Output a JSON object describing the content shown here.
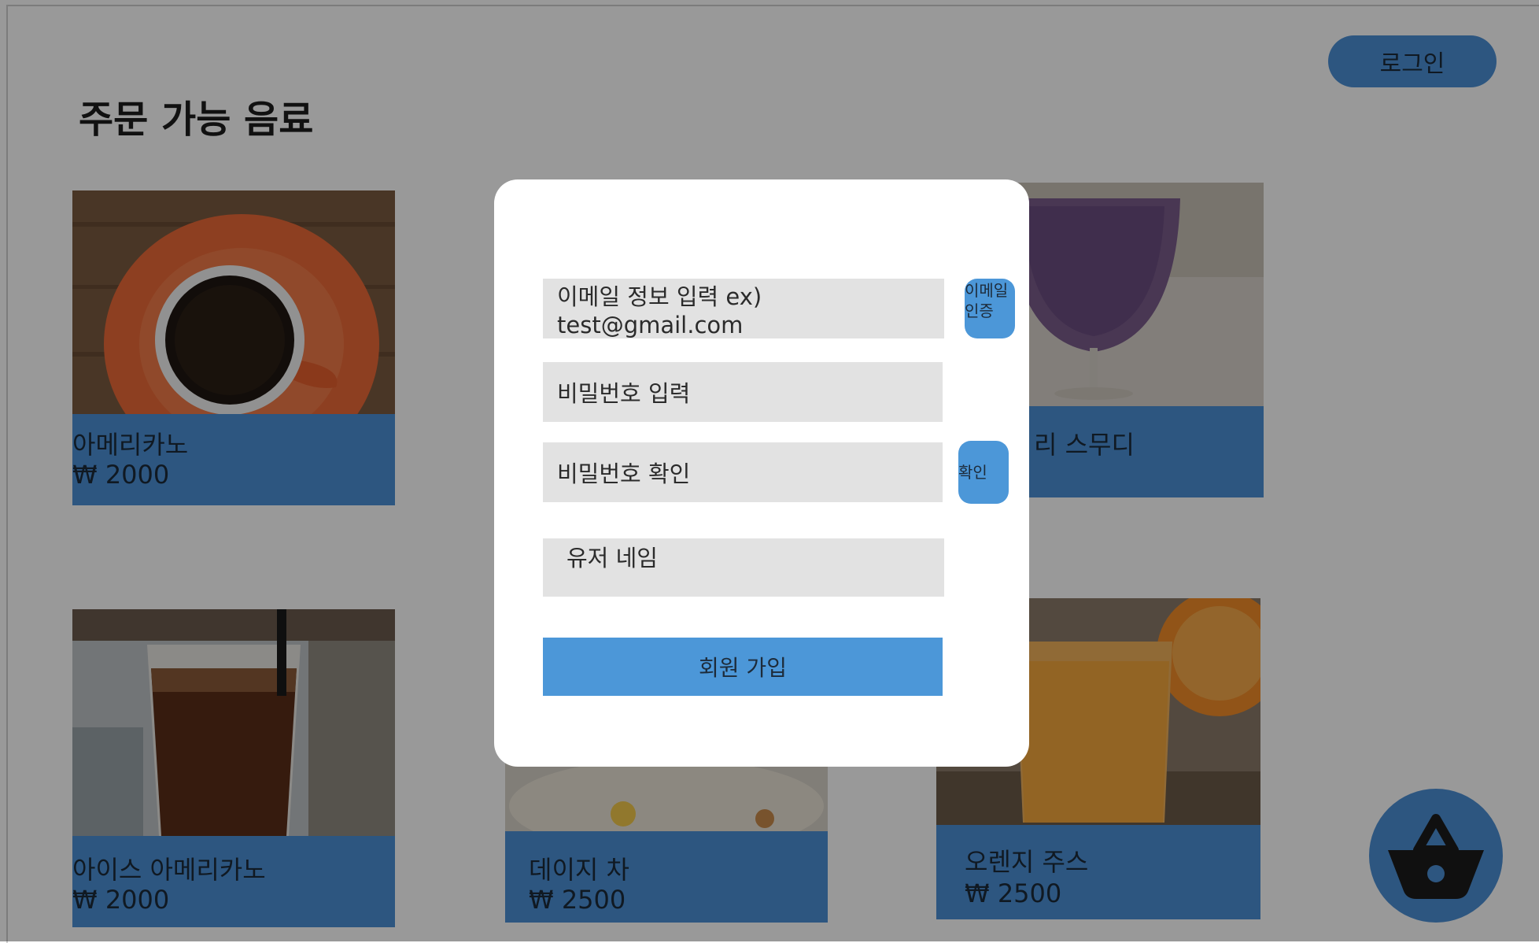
{
  "header": {
    "login_label": "로그인",
    "title": "주문 가능 음료"
  },
  "menu": {
    "items": [
      {
        "name": "아메리카노",
        "price": "₩ 2000"
      },
      {
        "name": "리 스무디",
        "price": ""
      },
      {
        "name": "아이스 아메리카노",
        "price": "₩ 2000"
      },
      {
        "name": "데이지 차",
        "price": "₩ 2500"
      },
      {
        "name": "오렌지 주스",
        "price": "₩ 2500"
      }
    ]
  },
  "signup_modal": {
    "email_field": "이메일 정보 입력 ex) test@gmail.com",
    "email_verify_button": "이메일 인증",
    "password_field": "비밀번호 입력",
    "password_confirm_field": "비밀번호 확인",
    "confirm_button": "확인",
    "username_field": "유저 네임",
    "submit_label": "회원 가입"
  },
  "colors": {
    "accent": "#4b8fd6",
    "overlay": "rgba(0,0,0,0.4)",
    "field_bg": "#e2e2e2"
  },
  "icons": {
    "cart": "shopping-basket-icon"
  }
}
